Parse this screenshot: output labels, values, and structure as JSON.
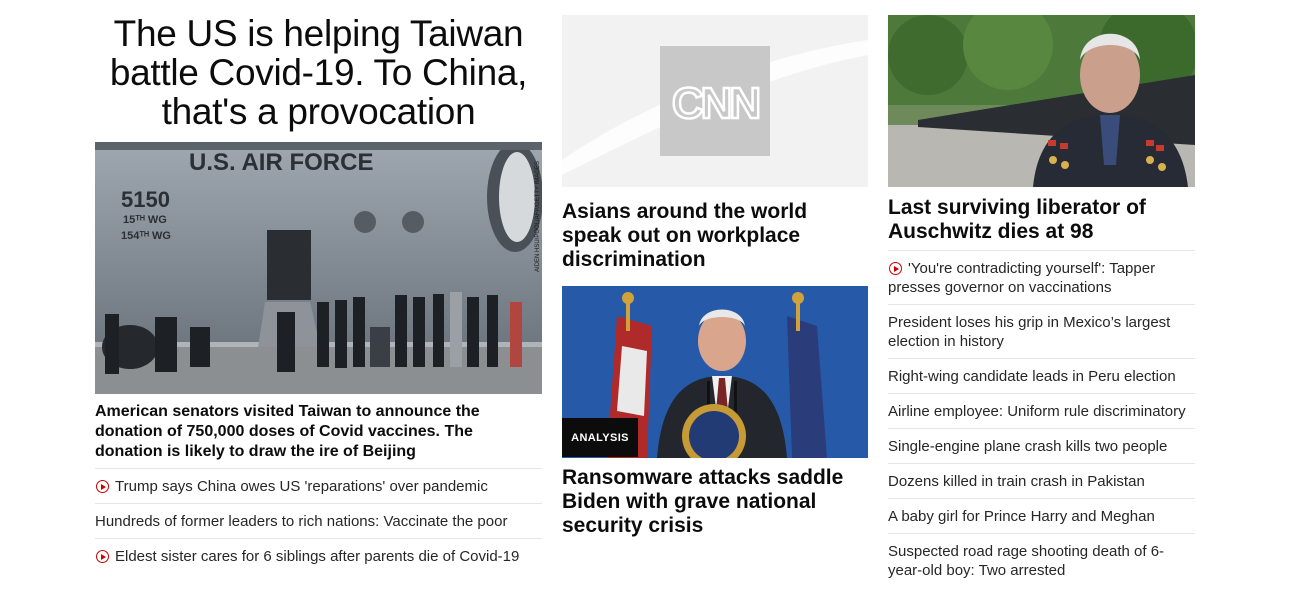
{
  "lead": {
    "headline": "The US is helping Taiwan battle Covid-19. To China, that's a provocation",
    "image": {
      "plane_text": "U.S. AIR FORCE",
      "tail_number": "5150",
      "wing_line1": "15ᵀᴴ WG",
      "wing_line2": "154ᵀᴴ WG",
      "credit": "AIDEN HSU/POOL/AFP/GETTY IMAGES"
    },
    "description": "American senators visited Taiwan to announce the donation of 750,000 doses of Covid vaccines. The donation is likely to draw the ire of Beijing",
    "list": [
      {
        "title": "Trump says China owes US 'reparations' over pandemic",
        "video": true
      },
      {
        "title": "Hundreds of former leaders to rich nations: Vaccinate the poor",
        "video": false
      },
      {
        "title": "Eldest sister cares for 6 siblings after parents die of Covid-19",
        "video": true
      }
    ]
  },
  "middle": {
    "story1": {
      "logo_text": "CNN",
      "headline": "Asians around the world speak out on workplace discrimination"
    },
    "story2": {
      "badge": "ANALYSIS",
      "headline": "Ransomware attacks saddle Biden with grave national security crisis"
    }
  },
  "right": {
    "headline": "Last surviving liberator of Auschwitz dies at 98",
    "list": [
      {
        "title": "'You're contradicting yourself': Tapper presses governor on vaccinations",
        "video": true
      },
      {
        "title": "President loses his grip in Mexico’s largest election in history",
        "video": false
      },
      {
        "title": "Right-wing candidate leads in Peru election",
        "video": false
      },
      {
        "title": "Airline employee: Uniform rule discriminatory",
        "video": false
      },
      {
        "title": "Single-engine plane crash kills two people",
        "video": false
      },
      {
        "title": "Dozens killed in train crash in Pakistan",
        "video": false
      },
      {
        "title": "A baby girl for Prince Harry and Meghan",
        "video": false
      },
      {
        "title": "Suspected road rage shooting death of 6-year-old boy: Two arrested",
        "video": false
      }
    ]
  },
  "colors": {
    "accent_red": "#cc0000",
    "text": "#262626",
    "badge_bg": "#0c0c0c"
  }
}
